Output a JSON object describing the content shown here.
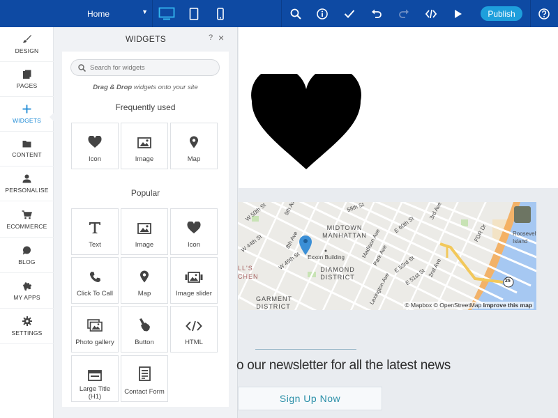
{
  "toolbar": {
    "page_selector": "Home",
    "publish_label": "Publish",
    "colors": {
      "bar": "#0e4aa3",
      "publish": "#1e9fdc"
    },
    "icons": [
      "desktop-icon",
      "tablet-icon",
      "mobile-icon",
      "search-icon",
      "info-icon",
      "check-icon",
      "undo-icon",
      "redo-icon",
      "code-icon",
      "play-icon",
      "help-icon"
    ]
  },
  "nav": {
    "items": [
      {
        "label": "DESIGN",
        "icon": "brush-icon"
      },
      {
        "label": "PAGES",
        "icon": "pages-icon"
      },
      {
        "label": "WIDGETS",
        "icon": "plus-icon",
        "active": true
      },
      {
        "label": "CONTENT",
        "icon": "folder-icon"
      },
      {
        "label": "PERSONALISE",
        "icon": "person-icon"
      },
      {
        "label": "ECOMMERCE",
        "icon": "cart-icon"
      },
      {
        "label": "BLOG",
        "icon": "chat-bubble-icon"
      },
      {
        "label": "MY APPS",
        "icon": "puzzle-icon"
      },
      {
        "label": "SETTINGS",
        "icon": "gear-icon"
      }
    ]
  },
  "panel": {
    "title": "WIDGETS",
    "help": "?",
    "close": "×",
    "search_placeholder": "Search for widgets",
    "hint_bold": "Drag & Drop",
    "hint_rest": " widgets onto your site",
    "frequently_used_title": "Frequently used",
    "frequently_used": [
      {
        "label": "Icon",
        "icon": "heart-icon"
      },
      {
        "label": "Image",
        "icon": "image-icon"
      },
      {
        "label": "Map",
        "icon": "map-pin-icon"
      }
    ],
    "popular_title": "Popular",
    "popular": [
      {
        "label": "Text",
        "icon": "text-icon"
      },
      {
        "label": "Image",
        "icon": "image-icon"
      },
      {
        "label": "Icon",
        "icon": "heart-icon"
      },
      {
        "label": "Click To Call",
        "icon": "phone-icon"
      },
      {
        "label": "Map",
        "icon": "map-pin-icon"
      },
      {
        "label": "Image slider",
        "icon": "image-slider-icon"
      },
      {
        "label": "Photo gallery",
        "icon": "photo-gallery-icon"
      },
      {
        "label": "Button",
        "icon": "hand-pointer-icon"
      },
      {
        "label": "HTML",
        "icon": "code-icon"
      },
      {
        "label": "Large Title (H1)",
        "icon": "title-box-icon"
      },
      {
        "label": "Contact Form",
        "icon": "form-icon"
      }
    ]
  },
  "canvas": {
    "map": {
      "labels": {
        "w50": "W 50th St",
        "ninth": "9th Ave",
        "w58": "58th St",
        "e60": "E 60th St",
        "third": "3rd Ave",
        "roosevelt": "Roosevelt Island",
        "midtown": "MIDTOWN MANHATTAN",
        "w44": "W 44th St",
        "eighth": "8th Ave",
        "w45": "W 45th St",
        "exxon": "Exxon Building",
        "madison": "Madison Ave",
        "park": "Park Ave",
        "e53": "E 53rd St",
        "e51": "E 51st St",
        "second": "2nd Ave",
        "fdr": "FDR Dr",
        "ells": "LL'S",
        "chen": "CHEN",
        "diamond": "DIAMOND DISTRICT",
        "lexington": "Lexington Ave",
        "garment": "GARMENT DISTRICT",
        "route": "25"
      },
      "attribution": "© Mapbox © OpenStreetMap",
      "improve": "Improve this map"
    },
    "newsletter": "o our newsletter for all the latest news",
    "signup_label": "Sign Up Now"
  }
}
